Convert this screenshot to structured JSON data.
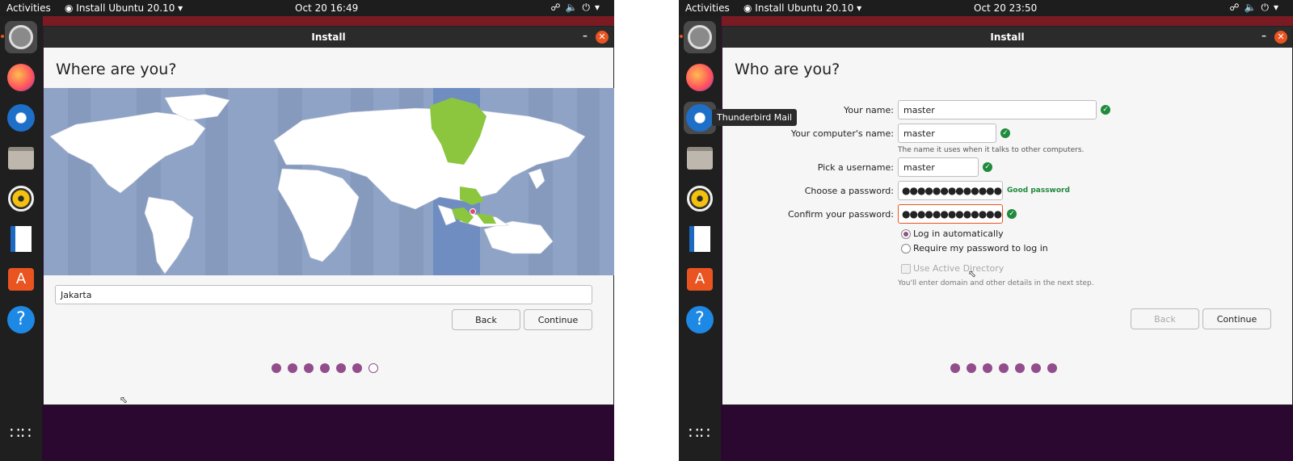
{
  "left": {
    "topbar": {
      "activities": "Activities",
      "app_menu": "Install Ubuntu 20.10 ▾",
      "clock": "Oct 20  16:49",
      "tray_icons": [
        "network-icon",
        "volume-icon",
        "power-icon",
        "chevron-down-icon"
      ]
    },
    "window": {
      "title": "Install",
      "minimize": "–",
      "close": "✕"
    },
    "page_title": "Where are you?",
    "location_value": "Jakarta",
    "buttons": {
      "back": "Back",
      "continue": "Continue"
    },
    "progress": {
      "total": 7,
      "completed": 6
    }
  },
  "right": {
    "topbar": {
      "activities": "Activities",
      "app_menu": "Install Ubuntu 20.10 ▾",
      "clock": "Oct 20  23:50",
      "tray_icons": [
        "network-icon",
        "volume-icon",
        "power-icon",
        "chevron-down-icon"
      ]
    },
    "window": {
      "title": "Install",
      "minimize": "–",
      "close": "✕"
    },
    "page_title": "Who are you?",
    "tooltip": "Thunderbird Mail",
    "form": {
      "name_label": "Your name:",
      "name_value": "master",
      "computer_label": "Your computer's name:",
      "computer_value": "master",
      "computer_hint": "The name it uses when it talks to other computers.",
      "username_label": "Pick a username:",
      "username_value": "master",
      "password_label": "Choose a password:",
      "password_value": "●●●●●●●●●●●●●",
      "password_strength": "Good password",
      "confirm_label": "Confirm your password:",
      "confirm_value": "●●●●●●●●●●●●●",
      "login_auto": "Log in automatically",
      "login_require": "Require my password to log in",
      "active_directory": "Use Active Directory",
      "ad_hint": "You'll enter domain and other details in the next step."
    },
    "buttons": {
      "back": "Back",
      "continue": "Continue"
    },
    "progress": {
      "total": 7,
      "completed": 7
    }
  },
  "dock_apps": [
    "ubuntu-installer-icon",
    "firefox-icon",
    "thunderbird-icon",
    "files-icon",
    "rhythmbox-icon",
    "libreoffice-writer-icon",
    "software-center-icon",
    "help-icon",
    "show-apps-icon"
  ],
  "colors": {
    "accent": "#924d8b",
    "ubuntu_orange": "#e95420",
    "selected_timezone": "#8cc63f",
    "ok_green": "#1e8a3c"
  }
}
